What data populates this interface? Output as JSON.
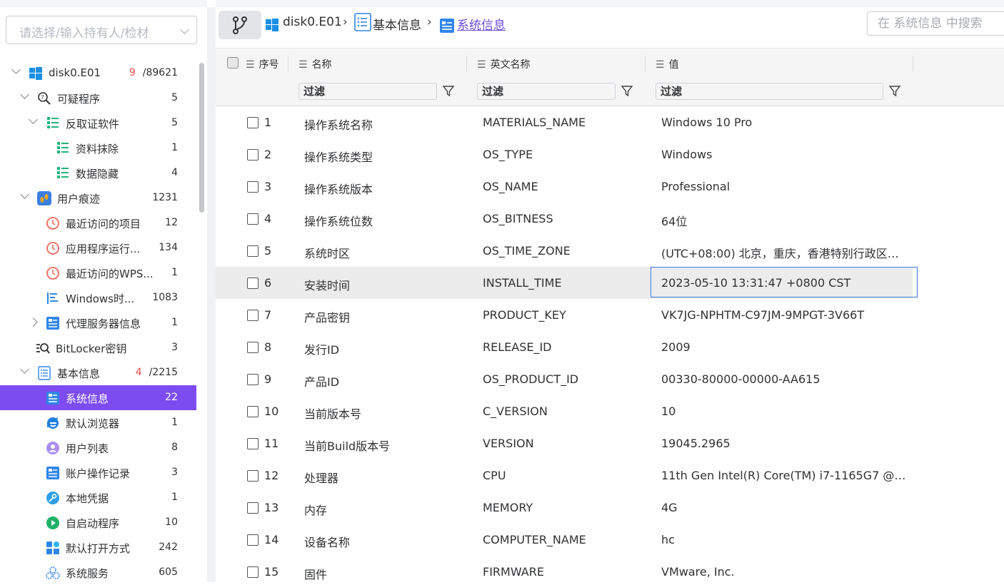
{
  "owner_select": {
    "placeholder": "请选择/输入持有人/检材"
  },
  "tree": [
    {
      "label": "disk0.E01",
      "count_red": "9",
      "count": "/89621",
      "icon": "windows-icon",
      "expand": "down",
      "level": 0
    },
    {
      "label": "可疑程序",
      "count": "5",
      "icon": "magnifier-question-icon",
      "expand": "down",
      "level": 1
    },
    {
      "label": "反取证软件",
      "count": "5",
      "icon": "list-green-icon",
      "expand": "down",
      "level": 2
    },
    {
      "label": "资料抹除",
      "count": "1",
      "icon": "list-green-icon",
      "level": 3
    },
    {
      "label": "数据隐藏",
      "count": "4",
      "icon": "list-green-icon",
      "level": 3
    },
    {
      "label": "用户痕迹",
      "count": "1231",
      "icon": "footprint-icon",
      "expand": "down",
      "level": 1
    },
    {
      "label": "最近访问的项目",
      "count": "12",
      "icon": "clock-red-icon",
      "level": 2
    },
    {
      "label": "应用程序运行...",
      "count": "134",
      "icon": "clock-red-icon",
      "level": 2
    },
    {
      "label": "最近访问的WPS...",
      "count": "1",
      "icon": "clock-red-icon",
      "level": 2
    },
    {
      "label": "Windows时...",
      "count": "1083",
      "icon": "timeline-icon",
      "level": 2
    },
    {
      "label": "代理服务器信息",
      "count": "1",
      "icon": "card-icon",
      "expand": "right",
      "level": 2
    },
    {
      "label": "BitLocker密钥",
      "count": "3",
      "icon": "key-search-icon",
      "level": 1
    },
    {
      "label": "基本信息",
      "count_red": "4",
      "count": "/2215",
      "icon": "doc-list-icon",
      "expand": "down",
      "level": 1
    },
    {
      "label": "系统信息",
      "count": "22",
      "icon": "card-icon",
      "level": 2,
      "selected": true
    },
    {
      "label": "默认浏览器",
      "count": "1",
      "icon": "ie-icon",
      "level": 2
    },
    {
      "label": "用户列表",
      "count": "8",
      "icon": "user-icon",
      "level": 2
    },
    {
      "label": "账户操作记录",
      "count": "3",
      "icon": "card-icon",
      "level": 2
    },
    {
      "label": "本地凭据",
      "count": "1",
      "icon": "key-icon",
      "level": 2
    },
    {
      "label": "自启动程序",
      "count": "10",
      "icon": "play-icon",
      "level": 2
    },
    {
      "label": "默认打开方式",
      "count": "242",
      "icon": "apps-icon",
      "level": 2
    },
    {
      "label": "系统服务",
      "count": "605",
      "icon": "gear-cluster-icon",
      "level": 2
    }
  ],
  "breadcrumb": [
    {
      "label": "disk0.E01",
      "icon": "windows-icon"
    },
    {
      "label": "基本信息",
      "icon": "doc-list-icon"
    },
    {
      "label": "系统信息",
      "icon": "card-icon"
    }
  ],
  "search": {
    "placeholder": "在 系统信息 中搜索"
  },
  "columns": {
    "index": "序号",
    "name": "名称",
    "english": "英文名称",
    "value": "值"
  },
  "filter": {
    "placeholder": "过滤"
  },
  "rows": [
    {
      "num": "1",
      "name": "操作系统名称",
      "en": "MATERIALS_NAME",
      "val": "Windows 10 Pro"
    },
    {
      "num": "2",
      "name": "操作系统类型",
      "en": "OS_TYPE",
      "val": "Windows"
    },
    {
      "num": "3",
      "name": "操作系统版本",
      "en": "OS_NAME",
      "val": "Professional"
    },
    {
      "num": "4",
      "name": "操作系统位数",
      "en": "OS_BITNESS",
      "val": "64位"
    },
    {
      "num": "5",
      "name": "系统时区",
      "en": "OS_TIME_ZONE",
      "val": "(UTC+08:00) 北京，重庆，香港特别行政区…"
    },
    {
      "num": "6",
      "name": "安装时间",
      "en": "INSTALL_TIME",
      "val": "2023-05-10 13:31:47 +0800 CST",
      "selected": true
    },
    {
      "num": "7",
      "name": "产品密钥",
      "en": "PRODUCT_KEY",
      "val": "VK7JG-NPHTM-C97JM-9MPGT-3V66T"
    },
    {
      "num": "8",
      "name": "发行ID",
      "en": "RELEASE_ID",
      "val": "2009"
    },
    {
      "num": "9",
      "name": "产品ID",
      "en": "OS_PRODUCT_ID",
      "val": "00330-80000-00000-AA615"
    },
    {
      "num": "10",
      "name": "当前版本号",
      "en": "C_VERSION",
      "val": "10"
    },
    {
      "num": "11",
      "name": "当前Build版本号",
      "en": "VERSION",
      "val": "19045.2965"
    },
    {
      "num": "12",
      "name": "处理器",
      "en": "CPU",
      "val": "11th Gen Intel(R) Core(TM) i7-1165G7 @ 2...."
    },
    {
      "num": "13",
      "name": "内存",
      "en": "MEMORY",
      "val": "4G"
    },
    {
      "num": "14",
      "name": "设备名称",
      "en": "COMPUTER_NAME",
      "val": "hc"
    },
    {
      "num": "15",
      "name": "固件",
      "en": "FIRMWARE",
      "val": "VMware, Inc."
    }
  ]
}
